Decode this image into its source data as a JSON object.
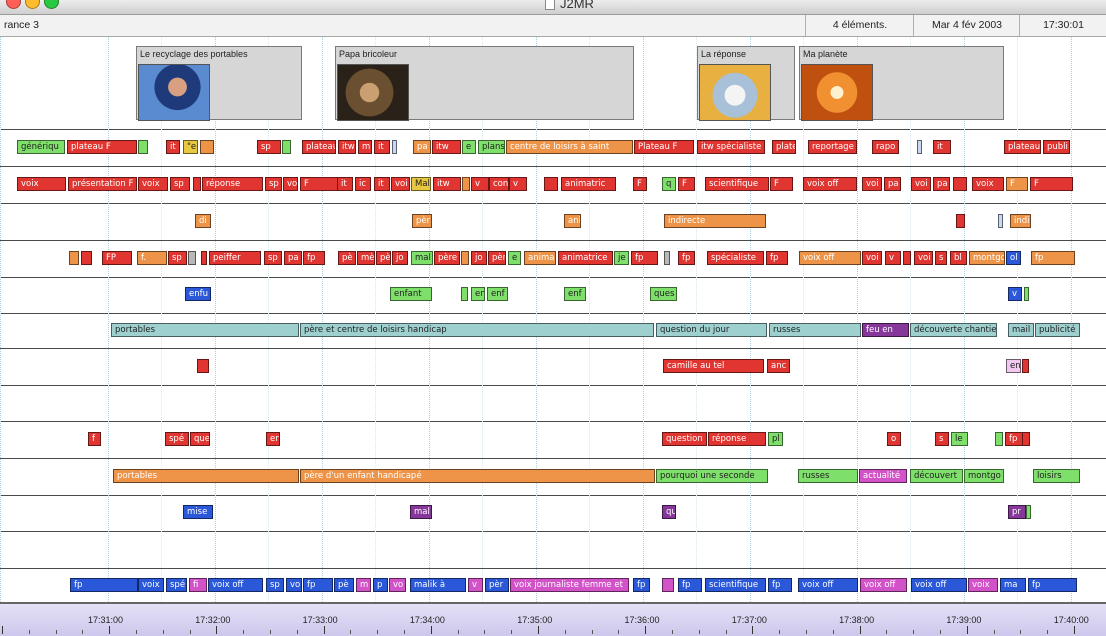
{
  "window": {
    "title": "J2MR"
  },
  "info_bar": {
    "channel": "rance 3",
    "count": "4 éléments.",
    "date": "Mar 4 fév 2003",
    "time": "17:30:01"
  },
  "thumbnails": [
    {
      "title": "Le recyclage des portables"
    },
    {
      "title": "Papa bricoleur"
    },
    {
      "title": "La réponse"
    },
    {
      "title": "Ma planète"
    }
  ],
  "colors": {
    "red": "#e03530",
    "orange": "#ee9448",
    "green": "#7ee06a",
    "teal": "#9ed0d0",
    "blue": "#2a58d8",
    "purple": "#86379a",
    "magenta": "#d252c8",
    "pink": "#f0c8f0",
    "yellow": "#e8c840",
    "lightblue": "#c8d8f0",
    "gray": "#b8b8b8"
  },
  "tracks": [
    [
      [
        "génériqu",
        "green"
      ],
      [
        "plateau F",
        "red"
      ],
      [
        "",
        "green"
      ],
      [
        "it",
        "red"
      ],
      [
        "\"e",
        "yellow"
      ],
      [
        "",
        "orange"
      ],
      [
        "sp",
        "red"
      ],
      [
        "",
        "green"
      ],
      [
        "plateau",
        "red"
      ],
      [
        "itw",
        "red"
      ],
      [
        "m",
        "red"
      ],
      [
        "it",
        "red"
      ],
      [
        "",
        "lightblue"
      ],
      [
        "pa",
        "orange"
      ],
      [
        "itw",
        "red"
      ],
      [
        "e",
        "green"
      ],
      [
        "plans",
        "green"
      ],
      [
        "centre de loisirs à saint",
        "orange"
      ],
      [
        "Plateau F",
        "red"
      ],
      [
        "itw spécialiste",
        "red"
      ],
      [
        "plate",
        "red"
      ],
      [
        "reportage",
        "red"
      ],
      [
        "rapo",
        "red"
      ],
      [
        "",
        "lightblue"
      ],
      [
        "it",
        "red"
      ],
      [
        "plateau",
        "red"
      ],
      [
        "publi",
        "red"
      ]
    ],
    [
      [
        "voix",
        "red"
      ],
      [
        "présentation F",
        "red"
      ],
      [
        "voix",
        "red"
      ],
      [
        "sp",
        "red"
      ],
      [
        "",
        "red"
      ],
      [
        "réponse",
        "red"
      ],
      [
        "sp",
        "red"
      ],
      [
        "vo",
        "red"
      ],
      [
        "F",
        "red"
      ],
      [
        "it",
        "red"
      ],
      [
        "ic",
        "red"
      ],
      [
        "it",
        "red"
      ],
      [
        "voi",
        "red"
      ],
      [
        "Mal",
        "yellow"
      ],
      [
        "itw",
        "red"
      ],
      [
        "",
        "orange"
      ],
      [
        "v",
        "red"
      ],
      [
        "con",
        "red"
      ],
      [
        "v",
        "red"
      ],
      [
        "",
        "red"
      ],
      [
        "animatric",
        "red"
      ],
      [
        "F",
        "red"
      ],
      [
        "q",
        "green"
      ],
      [
        "F",
        "red"
      ],
      [
        "scientifique",
        "red"
      ],
      [
        "F",
        "red"
      ],
      [
        "voix off",
        "red"
      ],
      [
        "voi",
        "red"
      ],
      [
        "pa",
        "red"
      ],
      [
        "voi",
        "red"
      ],
      [
        "pa",
        "red"
      ],
      [
        "",
        "red"
      ],
      [
        "voix",
        "red"
      ],
      [
        "F",
        "orange"
      ],
      [
        "F",
        "red"
      ]
    ],
    [
      [
        "di",
        "orange"
      ],
      [
        "pèr",
        "orange"
      ],
      [
        "ani",
        "orange"
      ],
      [
        "indirecte",
        "orange"
      ],
      [
        "",
        "red"
      ],
      [
        "",
        "lightblue"
      ],
      [
        "indi",
        "orange"
      ]
    ],
    [
      [
        "",
        "orange"
      ],
      [
        "",
        "red"
      ],
      [
        "FP",
        "red"
      ],
      [
        "f.",
        "orange"
      ],
      [
        "sp",
        "red"
      ],
      [
        "",
        "gray"
      ],
      [
        "",
        "red"
      ],
      [
        "peiffer",
        "red"
      ],
      [
        "sp",
        "red"
      ],
      [
        "pa",
        "red"
      ],
      [
        "fp",
        "red"
      ],
      [
        "pè",
        "red"
      ],
      [
        "mè",
        "red"
      ],
      [
        "pè",
        "red"
      ],
      [
        "jo",
        "red"
      ],
      [
        "mal",
        "green"
      ],
      [
        "père",
        "red"
      ],
      [
        "",
        "orange"
      ],
      [
        "jo",
        "red"
      ],
      [
        "pèr",
        "red"
      ],
      [
        "e",
        "green"
      ],
      [
        "anima",
        "orange"
      ],
      [
        "animatrice",
        "red"
      ],
      [
        "je",
        "green"
      ],
      [
        "fp",
        "red"
      ],
      [
        "",
        "gray"
      ],
      [
        "fp",
        "red"
      ],
      [
        "spécialiste",
        "red"
      ],
      [
        "fp",
        "red"
      ],
      [
        "voix off",
        "orange"
      ],
      [
        "voi",
        "red"
      ],
      [
        "v",
        "red"
      ],
      [
        "",
        "red"
      ],
      [
        "voi",
        "red"
      ],
      [
        "s",
        "red"
      ],
      [
        "bl",
        "red"
      ],
      [
        "montgo",
        "orange"
      ],
      [
        "ol",
        "blue"
      ],
      [
        "fp",
        "orange"
      ]
    ],
    [
      [
        "enfu",
        "blue"
      ],
      [
        "enfant",
        "green"
      ],
      [
        "",
        "green"
      ],
      [
        "en",
        "green"
      ],
      [
        "enf",
        "green"
      ],
      [
        "enf",
        "green"
      ],
      [
        "ques",
        "green"
      ],
      [
        "v",
        "blue"
      ],
      [
        "",
        "green"
      ]
    ],
    [
      [
        "portables",
        "teal"
      ],
      [
        "père et centre de loisirs handicap",
        "teal"
      ],
      [
        "question du jour",
        "teal"
      ],
      [
        "russes",
        "teal"
      ],
      [
        "feu en",
        "purple"
      ],
      [
        "découverte chantier",
        "teal"
      ],
      [
        "mail",
        "teal"
      ],
      [
        "publicité",
        "teal"
      ]
    ],
    [
      [
        "",
        "red"
      ],
      [
        "camille au tel",
        "red"
      ],
      [
        "anc",
        "red"
      ],
      [
        "en",
        "pink"
      ],
      [
        "",
        "red"
      ]
    ],
    [],
    [
      [
        "f",
        "red"
      ],
      [
        "spé",
        "red"
      ],
      [
        "que",
        "red"
      ],
      [
        "en",
        "red"
      ],
      [
        "question",
        "red"
      ],
      [
        "réponse",
        "red"
      ],
      [
        "pl",
        "green"
      ],
      [
        "o",
        "red"
      ],
      [
        "s",
        "red"
      ],
      [
        "le",
        "green"
      ],
      [
        "",
        "green"
      ],
      [
        "fp",
        "red"
      ],
      [
        "",
        "red"
      ]
    ],
    [
      [
        "portables",
        "orange"
      ],
      [
        "père d'un enfant handicapé",
        "orange"
      ],
      [
        "pourquoi une seconde",
        "green"
      ],
      [
        "russes",
        "green"
      ],
      [
        "actualité",
        "magenta"
      ],
      [
        "découvert",
        "green"
      ],
      [
        "montgo",
        "green"
      ],
      [
        "loisirs",
        "green"
      ]
    ],
    [
      [
        "mise",
        "blue"
      ],
      [
        "mal",
        "purple"
      ],
      [
        "qu",
        "purple"
      ],
      [
        "pr",
        "purple"
      ],
      [
        "",
        "green"
      ]
    ],
    [],
    [
      [
        "fp",
        "blue"
      ],
      [
        "voix",
        "blue"
      ],
      [
        "spé",
        "blue"
      ],
      [
        "fi",
        "magenta"
      ],
      [
        "voix off",
        "blue"
      ],
      [
        "sp",
        "blue"
      ],
      [
        "vo",
        "blue"
      ],
      [
        "fp",
        "blue"
      ],
      [
        "pè",
        "blue"
      ],
      [
        "m",
        "magenta"
      ],
      [
        "p",
        "blue"
      ],
      [
        "vo",
        "magenta"
      ],
      [
        "malik à",
        "blue"
      ],
      [
        "v",
        "magenta"
      ],
      [
        "pèr",
        "blue"
      ],
      [
        "voix journaliste femme et",
        "magenta"
      ],
      [
        "fp",
        "blue"
      ],
      [
        "",
        "magenta"
      ],
      [
        "fp",
        "blue"
      ],
      [
        "scientifique",
        "blue"
      ],
      [
        "fp",
        "blue"
      ],
      [
        "voix off",
        "blue"
      ],
      [
        "voix off",
        "magenta"
      ],
      [
        "voix off",
        "blue"
      ],
      [
        "voix",
        "magenta"
      ],
      [
        "ma",
        "blue"
      ],
      [
        "fp",
        "blue"
      ]
    ]
  ],
  "ruler": {
    "labels": [
      "17:31:00",
      "17:32:00",
      "17:33:00",
      "17:34:00",
      "17:35:00",
      "17:36:00",
      "17:37:00",
      "17:38:00",
      "17:39:00",
      "17:40:00"
    ]
  }
}
